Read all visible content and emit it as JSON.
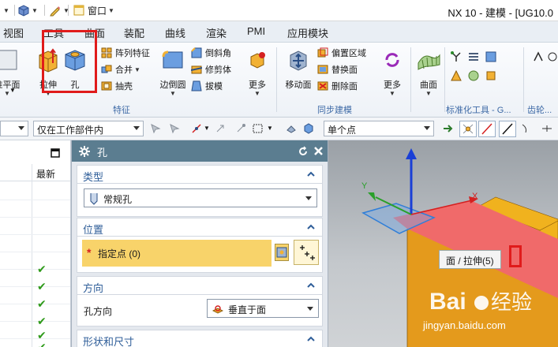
{
  "titlebar": {
    "window_menu_label": "窗口",
    "title": "NX 10 - 建模 - [UG10.0"
  },
  "menu_tabs": [
    "视图",
    "工具",
    "曲面",
    "装配",
    "曲线",
    "渲染",
    "PMI",
    "应用模块"
  ],
  "ribbon": {
    "datum_plane_label": "准平面",
    "extrude_label": "拉伸",
    "hole_label": "孔",
    "pattern_feature_label": "阵列特征",
    "unite_label": "合并",
    "shell_label": "抽壳",
    "edge_blend_label": "边倒圆",
    "chamfer_label": "倒斜角",
    "trim_body_label": "修剪体",
    "draft_label": "拔模",
    "more_label_1": "更多",
    "features_group_label": "特征",
    "move_face_label": "移动面",
    "offset_region_label": "偏置区域",
    "replace_face_label": "替换面",
    "delete_face_label": "删除面",
    "more_label_2": "更多",
    "sync_group_label": "同步建模",
    "surface_label": "曲面",
    "standard_group_label": "标准化工具 - G...",
    "gear_group_label": "齿轮..."
  },
  "filterbar": {
    "scope_value": "仅在工作部件内",
    "snap_value": "单个点"
  },
  "navigator": {
    "column_latest": "最新",
    "check_count": 6
  },
  "dialog": {
    "title": "孔",
    "type_section": "类型",
    "type_value": "常规孔",
    "position_section": "位置",
    "specify_point_label": "指定点 (0)",
    "direction_section": "方向",
    "hole_direction_label": "孔方向",
    "hole_direction_value": "垂直于面",
    "shape_section": "形状和尺寸"
  },
  "viewport": {
    "axis_y": "Y",
    "axis_x": "X",
    "tooltip": "面 / 拉伸(5)",
    "watermark_logo": "Baidu经验",
    "watermark_url": "jingyan.baidu.com"
  },
  "colors": {
    "ribbon_group_label": "#3e6aa6",
    "dialog_title_bg": "#5b7d90",
    "section_title": "#2f5e99",
    "selection_row_bg": "#f8d36a",
    "highlight_face": "#f06a6a",
    "body_color": "#e49a1c",
    "callout_red": "#e01b1b"
  }
}
